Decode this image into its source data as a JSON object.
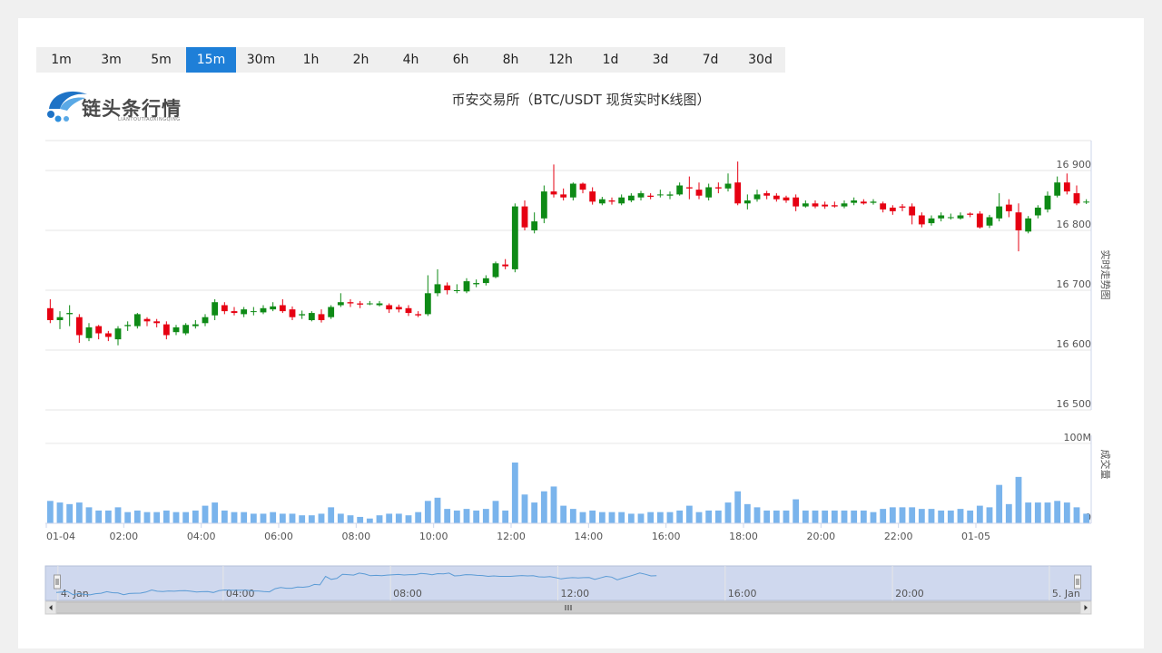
{
  "tabs": {
    "items": [
      "1m",
      "3m",
      "5m",
      "15m",
      "30m",
      "1h",
      "2h",
      "4h",
      "6h",
      "8h",
      "12h",
      "1d",
      "3d",
      "7d",
      "30d"
    ],
    "active": "15m"
  },
  "logo": {
    "text": "链头条行情",
    "sub": "LIANTOUTIAOXINGQING"
  },
  "colors": {
    "up": "#0e8a16",
    "down": "#e60012",
    "volume": "#7ab4ec",
    "active_tab": "#1e7fd8",
    "navigator_fill": "#cfd8ee"
  },
  "chart_data": {
    "type": "candlestick",
    "title": "币安交易所（BTC/USDT 现货实时K线图）",
    "price_axis": {
      "label": "实时走势图",
      "range": [
        16500,
        16950
      ],
      "ticks": [
        16500,
        16600,
        16700,
        16800,
        16900
      ],
      "tick_labels": [
        "16 500",
        "16 600",
        "16 700",
        "16 800",
        "16 900"
      ]
    },
    "volume_axis": {
      "label": "成交量",
      "range": [
        0,
        110
      ],
      "ticks": [
        0,
        100
      ],
      "tick_labels": [
        "0",
        "100M"
      ]
    },
    "x_axis": {
      "ticks": [
        0,
        8,
        16,
        24,
        32,
        40,
        48,
        56,
        64,
        72,
        80,
        88,
        96
      ],
      "tick_labels": [
        "01-04",
        "02:00",
        "04:00",
        "06:00",
        "08:00",
        "10:00",
        "12:00",
        "14:00",
        "16:00",
        "18:00",
        "20:00",
        "22:00",
        "01-05"
      ]
    },
    "candles": [
      [
        16670,
        16650,
        16685,
        16645,
        28
      ],
      [
        16650,
        16655,
        16665,
        16635,
        26
      ],
      [
        16660,
        16662,
        16675,
        16640,
        24
      ],
      [
        16655,
        16625,
        16660,
        16612,
        26
      ],
      [
        16620,
        16638,
        16645,
        16615,
        20
      ],
      [
        16640,
        16628,
        16642,
        16618,
        16
      ],
      [
        16628,
        16622,
        16632,
        16615,
        16
      ],
      [
        16618,
        16636,
        16640,
        16608,
        20
      ],
      [
        16640,
        16642,
        16648,
        16632,
        14
      ],
      [
        16640,
        16660,
        16662,
        16636,
        16
      ],
      [
        16652,
        16648,
        16655,
        16640,
        14
      ],
      [
        16648,
        16645,
        16652,
        16638,
        14
      ],
      [
        16643,
        16625,
        16648,
        16618,
        16
      ],
      [
        16630,
        16638,
        16642,
        16625,
        14
      ],
      [
        16628,
        16642,
        16645,
        16625,
        14
      ],
      [
        16640,
        16643,
        16650,
        16636,
        16
      ],
      [
        16645,
        16655,
        16660,
        16640,
        22
      ],
      [
        16658,
        16680,
        16685,
        16650,
        26
      ],
      [
        16675,
        16665,
        16680,
        16660,
        16
      ],
      [
        16665,
        16662,
        16672,
        16658,
        14
      ],
      [
        16660,
        16668,
        16672,
        16655,
        14
      ],
      [
        16665,
        16665,
        16672,
        16658,
        12
      ],
      [
        16663,
        16670,
        16675,
        16660,
        12
      ],
      [
        16668,
        16673,
        16680,
        16665,
        14
      ],
      [
        16675,
        16665,
        16685,
        16662,
        12
      ],
      [
        16668,
        16655,
        16673,
        16650,
        12
      ],
      [
        16658,
        16660,
        16666,
        16652,
        10
      ],
      [
        16650,
        16662,
        16665,
        16648,
        10
      ],
      [
        16660,
        16650,
        16668,
        16646,
        12
      ],
      [
        16655,
        16672,
        16675,
        16652,
        20
      ],
      [
        16675,
        16680,
        16695,
        16672,
        12
      ],
      [
        16680,
        16678,
        16685,
        16672,
        10
      ],
      [
        16678,
        16676,
        16682,
        16670,
        8
      ],
      [
        16677,
        16678,
        16682,
        16675,
        6
      ],
      [
        16675,
        16678,
        16682,
        16673,
        10
      ],
      [
        16675,
        16668,
        16678,
        16662,
        12
      ],
      [
        16672,
        16668,
        16676,
        16663,
        12
      ],
      [
        16670,
        16662,
        16675,
        16657,
        10
      ],
      [
        16660,
        16658,
        16665,
        16655,
        14
      ],
      [
        16660,
        16695,
        16725,
        16657,
        28
      ],
      [
        16695,
        16710,
        16735,
        16690,
        32
      ],
      [
        16708,
        16700,
        16713,
        16693,
        18
      ],
      [
        16700,
        16700,
        16710,
        16695,
        16
      ],
      [
        16698,
        16715,
        16720,
        16695,
        18
      ],
      [
        16710,
        16712,
        16718,
        16705,
        16
      ],
      [
        16712,
        16720,
        16725,
        16708,
        18
      ],
      [
        16722,
        16745,
        16748,
        16720,
        28
      ],
      [
        16743,
        16740,
        16752,
        16735,
        16
      ],
      [
        16735,
        16840,
        16845,
        16730,
        76
      ],
      [
        16840,
        16805,
        16850,
        16800,
        36
      ],
      [
        16800,
        16815,
        16830,
        16795,
        26
      ],
      [
        16820,
        16865,
        16875,
        16812,
        40
      ],
      [
        16865,
        16860,
        16910,
        16855,
        46
      ],
      [
        16860,
        16855,
        16870,
        16850,
        22
      ],
      [
        16855,
        16878,
        16880,
        16850,
        18
      ],
      [
        16878,
        16868,
        16880,
        16862,
        14
      ],
      [
        16865,
        16848,
        16872,
        16843,
        16
      ],
      [
        16845,
        16852,
        16856,
        16842,
        14
      ],
      [
        16850,
        16848,
        16855,
        16843,
        14
      ],
      [
        16845,
        16855,
        16860,
        16842,
        14
      ],
      [
        16850,
        16858,
        16862,
        16847,
        12
      ],
      [
        16855,
        16862,
        16866,
        16850,
        12
      ],
      [
        16858,
        16856,
        16862,
        16852,
        14
      ],
      [
        16860,
        16860,
        16868,
        16855,
        14
      ],
      [
        16858,
        16860,
        16865,
        16852,
        14
      ],
      [
        16860,
        16875,
        16880,
        16858,
        16
      ],
      [
        16872,
        16870,
        16890,
        16852,
        22
      ],
      [
        16868,
        16858,
        16880,
        16852,
        14
      ],
      [
        16855,
        16872,
        16878,
        16850,
        16
      ],
      [
        16872,
        16870,
        16880,
        16862,
        16
      ],
      [
        16870,
        16878,
        16895,
        16865,
        26
      ],
      [
        16880,
        16845,
        16915,
        16842,
        40
      ],
      [
        16845,
        16850,
        16860,
        16835,
        24
      ],
      [
        16852,
        16860,
        16868,
        16848,
        20
      ],
      [
        16862,
        16858,
        16866,
        16852,
        16
      ],
      [
        16858,
        16852,
        16862,
        16848,
        16
      ],
      [
        16855,
        16850,
        16858,
        16846,
        16
      ],
      [
        16855,
        16840,
        16860,
        16832,
        30
      ],
      [
        16840,
        16845,
        16850,
        16838,
        16
      ],
      [
        16845,
        16840,
        16850,
        16837,
        16
      ],
      [
        16843,
        16840,
        16848,
        16836,
        16
      ],
      [
        16842,
        16840,
        16848,
        16838,
        16
      ],
      [
        16840,
        16845,
        16850,
        16837,
        16
      ],
      [
        16846,
        16850,
        16855,
        16842,
        16
      ],
      [
        16848,
        16845,
        16852,
        16843,
        16
      ],
      [
        16846,
        16848,
        16852,
        16843,
        14
      ],
      [
        16845,
        16835,
        16848,
        16830,
        18
      ],
      [
        16838,
        16832,
        16842,
        16826,
        20
      ],
      [
        16840,
        16838,
        16844,
        16832,
        20
      ],
      [
        16840,
        16825,
        16845,
        16810,
        20
      ],
      [
        16825,
        16810,
        16830,
        16805,
        18
      ],
      [
        16812,
        16820,
        16825,
        16808,
        18
      ],
      [
        16820,
        16825,
        16830,
        16815,
        16
      ],
      [
        16822,
        16822,
        16828,
        16818,
        16
      ],
      [
        16820,
        16825,
        16830,
        16818,
        18
      ],
      [
        16828,
        16826,
        16830,
        16822,
        16
      ],
      [
        16828,
        16805,
        16832,
        16803,
        22
      ],
      [
        16808,
        16822,
        16826,
        16804,
        20
      ],
      [
        16820,
        16840,
        16862,
        16815,
        48
      ],
      [
        16843,
        16832,
        16852,
        16822,
        24
      ],
      [
        16830,
        16800,
        16845,
        16765,
        58
      ],
      [
        16798,
        16820,
        16824,
        16795,
        26
      ],
      [
        16825,
        16838,
        16842,
        16820,
        26
      ],
      [
        16835,
        16858,
        16865,
        16830,
        26
      ],
      [
        16858,
        16880,
        16890,
        16855,
        28
      ],
      [
        16880,
        16865,
        16895,
        16860,
        26
      ],
      [
        16862,
        16845,
        16875,
        16842,
        20
      ],
      [
        16848,
        16848,
        16852,
        16844,
        12
      ]
    ],
    "navigator_ticks": [
      "4. Jan",
      "04:00",
      "08:00",
      "12:00",
      "16:00",
      "20:00",
      "5. Jan"
    ]
  }
}
